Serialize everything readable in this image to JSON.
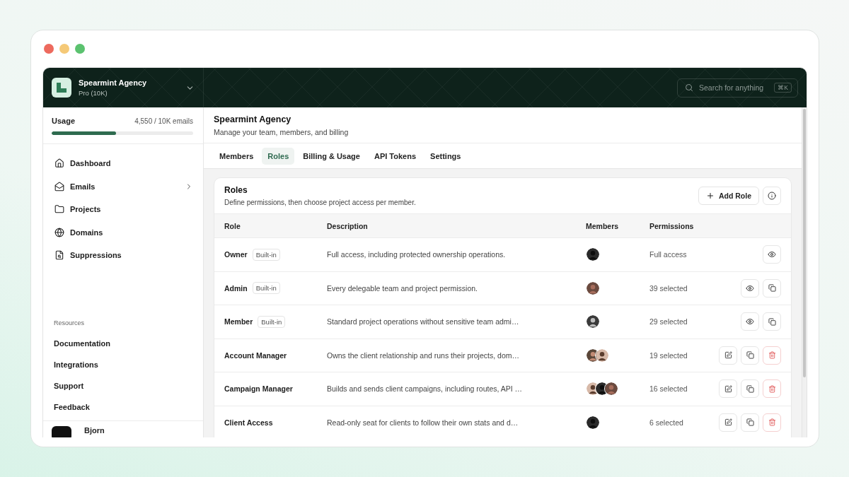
{
  "org": {
    "name": "Spearmint Agency",
    "plan": "Pro (10K)",
    "expanded": false
  },
  "search": {
    "placeholder": "Search for anything",
    "shortcut": "⌘K"
  },
  "usage": {
    "label": "Usage",
    "reading": "4,550 / 10K emails",
    "level": 0.455
  },
  "nav": [
    {
      "label": "Dashboard"
    },
    {
      "label": "Emails",
      "expanded": false
    },
    {
      "label": "Projects"
    },
    {
      "label": "Domains"
    },
    {
      "label": "Suppressions"
    }
  ],
  "resources": {
    "title": "Resources",
    "items": [
      "Documentation",
      "Integrations",
      "Support",
      "Feedback"
    ]
  },
  "user": {
    "name": "Bjorn"
  },
  "page": {
    "title": "Spearmint Agency",
    "subtitle": "Manage your team, members, and billing"
  },
  "tabs": [
    {
      "label": "Members",
      "selected": false
    },
    {
      "label": "Roles",
      "selected": true
    },
    {
      "label": "Billing & Usage",
      "selected": false
    },
    {
      "label": "API Tokens",
      "selected": false
    },
    {
      "label": "Settings",
      "selected": false
    }
  ],
  "roles_card": {
    "title": "Roles",
    "subtitle": "Define permissions, then choose project access per member.",
    "add_button": "Add Role"
  },
  "table": {
    "columns": [
      "Role",
      "Description",
      "Members",
      "Permissions"
    ],
    "rows": [
      {
        "role": "Owner",
        "badge": "Built-in",
        "description": "Full access, including protected ownership operations.",
        "avatars": [
          {
            "kind": "picture"
          }
        ],
        "permissions": "Full access",
        "actions": [
          {
            "kind": "view"
          }
        ]
      },
      {
        "role": "Admin",
        "badge": "Built-in",
        "description": "Every delegable team and project permission.",
        "avatars": [
          {
            "kind": "picture"
          }
        ],
        "permissions": "39 selected",
        "actions": [
          {
            "kind": "view"
          },
          {
            "kind": "duplicate"
          }
        ]
      },
      {
        "role": "Member",
        "badge": "Built-in",
        "description": "Standard project operations without sensitive team admi…",
        "avatars": [
          {
            "kind": "picture"
          }
        ],
        "permissions": "29 selected",
        "actions": [
          {
            "kind": "view"
          },
          {
            "kind": "duplicate"
          }
        ]
      },
      {
        "role": "Account Manager",
        "description": "Owns the client relationship and runs their projects, dom…",
        "avatars": [
          {
            "kind": "picture"
          },
          {
            "kind": "picture"
          }
        ],
        "permissions": "19 selected",
        "actions": [
          {
            "kind": "edit"
          },
          {
            "kind": "duplicate"
          },
          {
            "kind": "delete"
          }
        ]
      },
      {
        "role": "Campaign Manager",
        "description": "Builds and sends client campaigns, including routes, API …",
        "avatars": [
          {
            "kind": "picture"
          },
          {
            "kind": "picture"
          },
          {
            "kind": "picture"
          }
        ],
        "permissions": "16 selected",
        "actions": [
          {
            "kind": "edit"
          },
          {
            "kind": "duplicate"
          },
          {
            "kind": "delete"
          }
        ]
      },
      {
        "role": "Client Access",
        "description": "Read-only seat for clients to follow their own stats and d…",
        "avatars": [
          {
            "kind": "picture"
          }
        ],
        "permissions": "6 selected",
        "actions": [
          {
            "kind": "edit"
          },
          {
            "kind": "duplicate"
          },
          {
            "kind": "delete"
          }
        ]
      }
    ]
  }
}
